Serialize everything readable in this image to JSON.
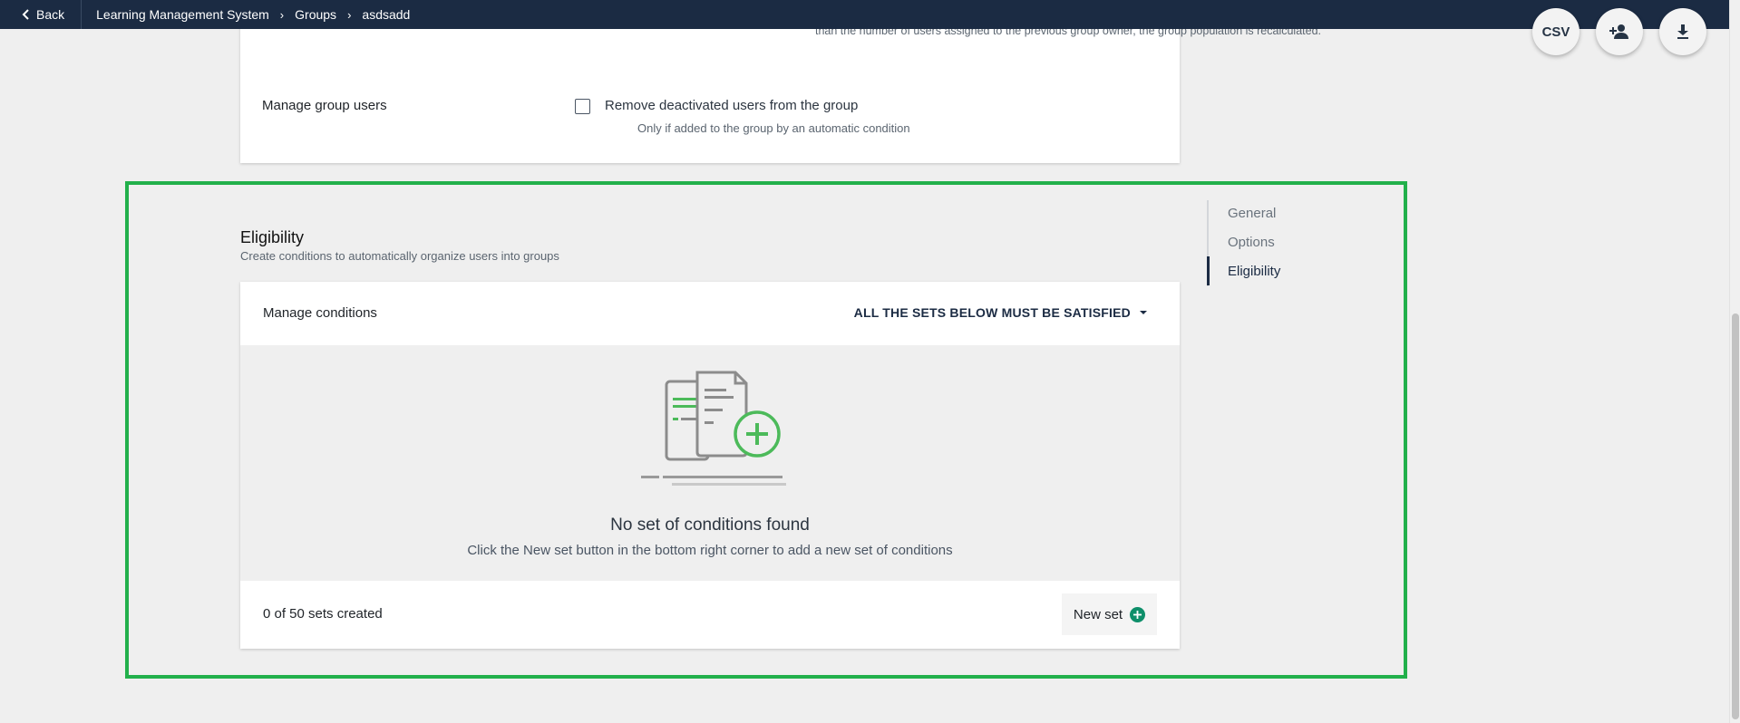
{
  "topbar": {
    "back_label": "Back",
    "breadcrumbs": [
      "Learning Management System",
      "Groups",
      "asdsadd"
    ]
  },
  "fabs": {
    "csv_label": "CSV",
    "add_user_icon": "add-user-icon",
    "download_icon": "download-icon"
  },
  "options": {
    "cut_off_text": "than the number of users assigned to the previous group owner, the group population is recalculated.",
    "manage_group_users_label": "Manage group users",
    "remove_deactivated_label": "Remove deactivated users from the group",
    "remove_deactivated_help": "Only if added to the group by an automatic condition",
    "remove_deactivated_checked": false
  },
  "eligibility": {
    "title": "Eligibility",
    "subtitle": "Create conditions to automatically organize users into groups",
    "manage_conditions_label": "Manage conditions",
    "rule_select_value": "ALL THE SETS BELOW MUST BE SATISFIED",
    "empty_title": "No set of conditions found",
    "empty_help": "Click the New set button in the bottom right corner to add a new set of conditions",
    "sets_count": "0 of 50 sets created",
    "new_set_label": "New set"
  },
  "anchor_nav": {
    "items": [
      "General",
      "Options",
      "Eligibility"
    ],
    "active": "Eligibility"
  },
  "colors": {
    "topbar": "#1b2b43",
    "highlight": "#22b04b",
    "accent_green": "#0e8f6a",
    "illustration_green": "#4cba5a"
  }
}
